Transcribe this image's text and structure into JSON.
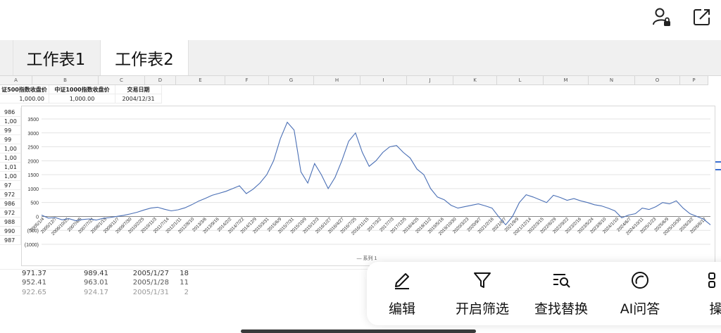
{
  "tabs": [
    {
      "label": "工作表1",
      "active": false
    },
    {
      "label": "工作表2",
      "active": true
    }
  ],
  "columns": [
    "A",
    "B",
    "C",
    "D",
    "E",
    "F",
    "G",
    "H",
    "I",
    "J",
    "K",
    "L",
    "M",
    "N",
    "O",
    "P"
  ],
  "headers": {
    "a": "证500指数收盘价",
    "b": "中证1000指数收盘价",
    "c": "交易日期"
  },
  "first_row": {
    "a": "1,000.00",
    "b": "1,000.00",
    "c": "2004/12/31"
  },
  "left_column_values": [
    "986",
    "1,00",
    "99",
    "99",
    "1,00",
    "1,00",
    "1,01",
    "1,00",
    "97",
    "972",
    "986",
    "972",
    "988",
    "990",
    "987"
  ],
  "bottom_rows": [
    {
      "a": "971.37",
      "b": "989.41",
      "c": "2005/1/27",
      "d": "18"
    },
    {
      "a": "952.41",
      "b": "963.01",
      "c": "2005/1/28",
      "d": "11"
    },
    {
      "a": "922.65",
      "b": "924.17",
      "c": "2005/1/31",
      "d": "2"
    }
  ],
  "chart_data": {
    "type": "line",
    "title": "",
    "xlabel": "",
    "ylabel": "",
    "ylim": [
      -1000,
      3500
    ],
    "y_ticks": [
      "3500",
      "3000",
      "2500",
      "2000",
      "1500",
      "1000",
      "500",
      "0",
      "(500)",
      "(1000)"
    ],
    "y_tick_values": [
      3500,
      3000,
      2500,
      2000,
      1500,
      1000,
      500,
      0,
      -500,
      -1000
    ],
    "x_ticks": [
      "2005/1/4",
      "2005/12/7",
      "2006/10/25",
      "2007/9/13",
      "2008/8/6",
      "2009/6/29",
      "2010/5/24",
      "2011/4/18",
      "2012/3/8",
      "2013/1/29",
      "2013/12/23",
      "2014/11/16",
      "2015/10/9",
      "2016/9/1",
      "2017/7/27",
      "2018/6/20",
      "2019/5/14",
      "2020/4/6",
      "2021/2/27",
      "2022/1/20",
      "2022/12/14",
      "2023/11/7",
      "2024/10/1",
      "2025/8/25",
      "2026/6/12"
    ],
    "x_tick_labels_visible": [
      "2005/1/4",
      "2005/12/7",
      "2006/10/25",
      "2007/4/5",
      "2007/7/21",
      "2008/1/15",
      "2008/11/7",
      "2009/7/30",
      "2010/2/25",
      "2010/11/3",
      "2011/7/14",
      "2012/1/11",
      "2012/8/10",
      "2013/3/6",
      "2013/9/16",
      "2014/2/2",
      "2014/7/22",
      "2014/12/9",
      "2015/3/31",
      "2015/6/9",
      "2015/7/31",
      "2015/10/9",
      "2015/12/3",
      "2016/1/27",
      "2016/4/27",
      "2016/7/25",
      "2016/11/15",
      "2017/3/2",
      "2017/7/3",
      "2017/12/5",
      "2018/4/25",
      "2018/11/2",
      "2019/5/16",
      "2019/10/30",
      "2020/3/23",
      "2020/9/7",
      "2021/2/16",
      "2021/6/7",
      "2021/9/9",
      "2021/12/14",
      "2022/3/15",
      "2022/6/29",
      "2022/9/22",
      "2023/2/16",
      "2023/5/24",
      "2023/8/10",
      "2024/1/10",
      "2024/6/7",
      "2024/10/11",
      "2025/1/23",
      "2025/6/9",
      "2025/10/30",
      "2026/3/2",
      "2026/6/12"
    ],
    "series": [
      {
        "name": "系列 1",
        "color": "#4a6fb5",
        "values": [
          50,
          -60,
          -40,
          -120,
          -80,
          -150,
          -110,
          -90,
          -130,
          -70,
          -40,
          0,
          40,
          90,
          150,
          230,
          300,
          330,
          260,
          200,
          240,
          310,
          420,
          550,
          650,
          760,
          830,
          900,
          1000,
          1100,
          820,
          980,
          1200,
          1500,
          2000,
          2800,
          3380,
          3100,
          1600,
          1200,
          1900,
          1500,
          1000,
          1400,
          2000,
          2700,
          3000,
          2300,
          1800,
          2000,
          2300,
          2500,
          2550,
          2300,
          2100,
          1700,
          1500,
          1000,
          700,
          600,
          400,
          300,
          350,
          400,
          450,
          380,
          300,
          -20,
          -300,
          0,
          500,
          780,
          700,
          600,
          500,
          760,
          680,
          580,
          640,
          560,
          500,
          420,
          380,
          300,
          200,
          -50,
          50,
          100,
          300,
          250,
          350,
          500,
          450,
          560,
          300,
          100,
          0,
          -100,
          -300
        ]
      }
    ],
    "legend": {
      "label": "— 系列 1",
      "position": "bottom"
    }
  },
  "actions": [
    {
      "label": "编辑",
      "icon": "edit-pencil-icon"
    },
    {
      "label": "开启筛选",
      "icon": "filter-icon"
    },
    {
      "label": "查找替换",
      "icon": "find-replace-icon"
    },
    {
      "label": "AI问答",
      "icon": "ai-chat-icon"
    },
    {
      "label": "操",
      "icon": "grid-icon"
    }
  ],
  "toolbar": {
    "account_icon": "user-lock-icon",
    "share_icon": "share-export-icon"
  }
}
